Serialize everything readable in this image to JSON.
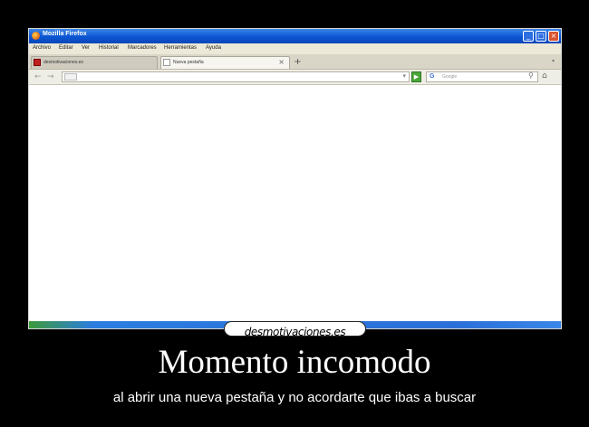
{
  "window": {
    "title": "Mozilla Firefox",
    "controls": {
      "minimize": "_",
      "maximize": "□",
      "close": "×"
    }
  },
  "menu": [
    "Archivo",
    "Editar",
    "Ver",
    "Historial",
    "Marcadores",
    "Herramientas",
    "Ayuda"
  ],
  "tabs": [
    {
      "label": "desmotivaciones.es",
      "icon": "site-favicon"
    },
    {
      "label": "Nueva pestaña",
      "icon": "blank-page-icon",
      "close": "×"
    }
  ],
  "new_tab": "+",
  "navigation": {
    "back": "←",
    "forward": "→",
    "url_value": "",
    "go": "▶",
    "search_engine": "G",
    "search_placeholder": "Google",
    "search_icon": "magnifier-icon",
    "home_icon": "home-icon"
  },
  "watermark": "desmotivaciones.es",
  "poster": {
    "title": "Momento incomodo",
    "caption": "al abrir una nueva pestaña y no acordarte que ibas a buscar"
  },
  "colors": {
    "background": "#000000",
    "titlebar": "#0b55d2",
    "close_button": "#d9532c",
    "go_button": "#4aa63b"
  }
}
